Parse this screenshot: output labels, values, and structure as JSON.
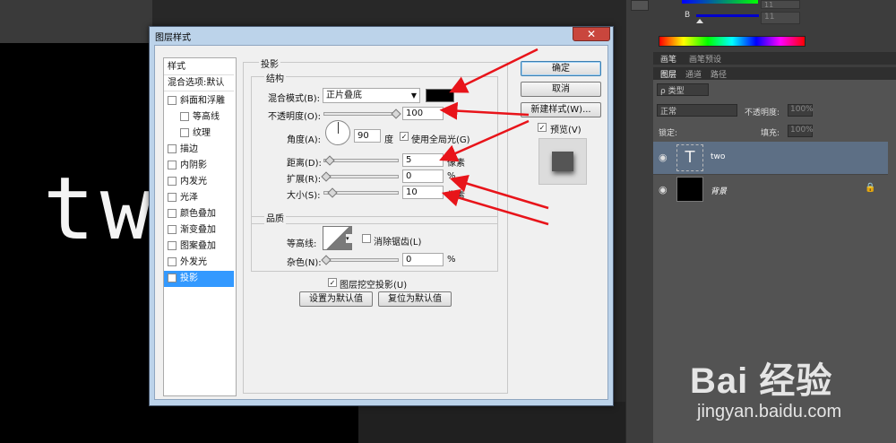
{
  "background": {
    "layer_text": "tw"
  },
  "right_panel": {
    "channel_b_label": "B",
    "channel_value_1": "11",
    "channel_value_2": "11",
    "tabs_top": [
      "画笔",
      "画笔预设"
    ],
    "tabs_layers": [
      "图层",
      "通道",
      "路径"
    ],
    "filter_type": "ρ 类型",
    "blend_mode": "正常",
    "opacity_label": "不透明度:",
    "opacity_value": "100%",
    "lock_label": "锁定:",
    "fill_label": "填充:",
    "fill_value": "100%",
    "layers": [
      {
        "name": "two",
        "thumb": "T"
      },
      {
        "name": "背景",
        "thumb": ""
      }
    ]
  },
  "dialog": {
    "title": "图层样式",
    "close": "✕",
    "left_list": {
      "header": "样式",
      "blend_options": "混合选项:默认",
      "items": [
        {
          "label": "斜面和浮雕",
          "checked": false
        },
        {
          "label": "等高线",
          "checked": false
        },
        {
          "label": "纹理",
          "checked": false
        },
        {
          "label": "描边",
          "checked": false
        },
        {
          "label": "内阴影",
          "checked": false
        },
        {
          "label": "内发光",
          "checked": false
        },
        {
          "label": "光泽",
          "checked": false
        },
        {
          "label": "颜色叠加",
          "checked": false
        },
        {
          "label": "渐变叠加",
          "checked": false
        },
        {
          "label": "图案叠加",
          "checked": false
        },
        {
          "label": "外发光",
          "checked": false
        },
        {
          "label": "投影",
          "checked": true
        }
      ]
    },
    "section_title": "投影",
    "structure": {
      "title": "结构",
      "blend_mode_label": "混合模式(B):",
      "blend_mode_value": "正片叠底",
      "opacity_label": "不透明度(O):",
      "opacity_value": "100",
      "opacity_unit": "%",
      "opacity_level": 1.0,
      "angle_label": "角度(A):",
      "angle_value": "90",
      "angle_unit": "度",
      "global_light_label": "使用全局光(G)",
      "global_light_checked": true,
      "distance_label": "距离(D):",
      "distance_value": "5",
      "distance_unit": "像素",
      "spread_label": "扩展(R):",
      "spread_value": "0",
      "spread_unit": "%",
      "size_label": "大小(S):",
      "size_value": "10",
      "size_unit": "像素"
    },
    "quality": {
      "title": "品质",
      "contour_label": "等高线:",
      "antialias_label": "消除锯齿(L)",
      "noise_label": "杂色(N):",
      "noise_value": "0",
      "noise_unit": "%"
    },
    "knockout_label": "图层挖空投影(U)",
    "set_default": "设置为默认值",
    "reset_default": "复位为默认值",
    "ok": "确定",
    "cancel": "取消",
    "new_style": "新建样式(W)...",
    "preview_label": "预览(V)",
    "preview_checked": true
  },
  "watermark": {
    "brand": "Bai 经验",
    "url": "jingyan.baidu.com"
  },
  "colors": {
    "arrow": "#e8141a",
    "selected": "#3399ff",
    "dialog_frame": "#bcd3ea"
  }
}
